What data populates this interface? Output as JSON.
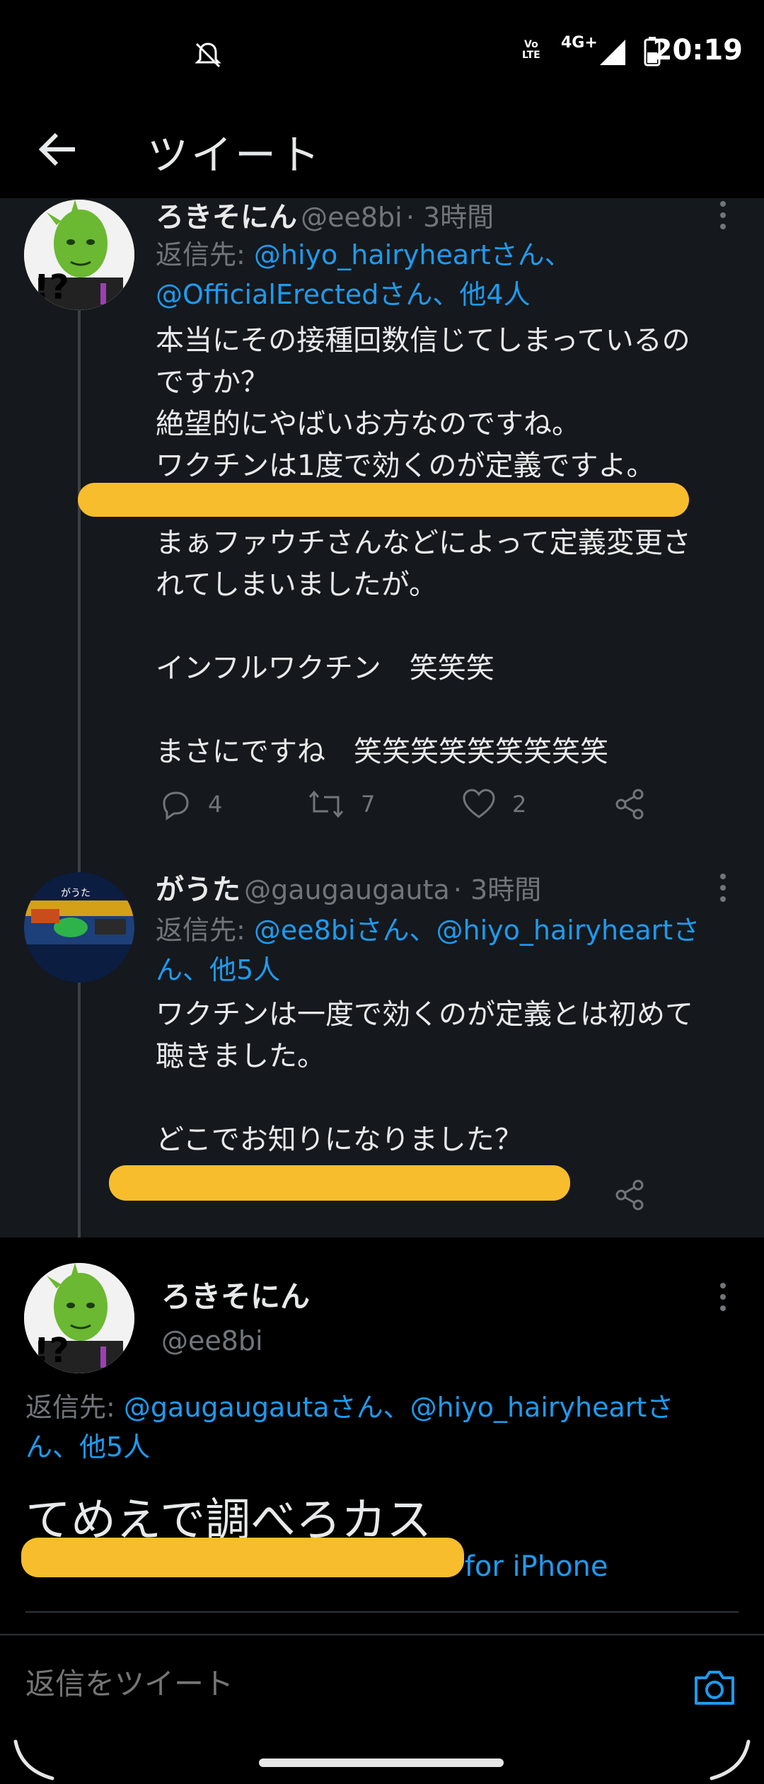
{
  "status_bar": {
    "time": "20:19",
    "network": "4G+",
    "volte": "Vo\nLTE"
  },
  "header": {
    "title": "ツイート"
  },
  "tweets": [
    {
      "name": "ろきそにん",
      "handle": "@ee8bi",
      "time": "· 3時間",
      "reply_prefix": "返信先:",
      "reply_links": "@hiyo_hairyheartさん、",
      "reply_links_2": "@OfficialErectedさん、他4人",
      "body_1": "本当にその接種回数信じてしまっているの\nですか？\n絶望的にやばいお方なのですね。\nワクチンは1度で効くのが定義ですよ。",
      "body_2": "まぁファウチさんなどによって定義変更さ\nれてしまいましたが。\n\nインフルワクチン　笑笑笑\n\nまさにですね　笑笑笑笑笑笑笑笑笑",
      "replies": "4",
      "retweets": "7",
      "likes": "2"
    },
    {
      "name": "がうた",
      "handle": "@gaugaugauta",
      "time": "· 3時間",
      "reply_prefix": "返信先:",
      "reply_links": "@ee8biさん、@hiyo_hairyheartさ",
      "reply_links_2": "ん、他5人",
      "body_1": "ワクチンは一度で効くのが定義とは初めて\n聴きました。\n\nどこでお知りになりました？"
    }
  ],
  "main_tweet": {
    "name": "ろきそにん",
    "handle": "@ee8bi",
    "reply_prefix": "返信先:",
    "reply_links": "@gaugaugautaさん、@hiyo_hairyheartさ",
    "reply_links_2": "ん、他5人",
    "text": "てめえで調べろカス",
    "client": "Twitter for iPhone"
  },
  "composer": {
    "placeholder": "返信をツイート"
  },
  "colors": {
    "link": "#1d9bf0",
    "highlight": "#f8bd2c",
    "muted": "#71767b"
  }
}
